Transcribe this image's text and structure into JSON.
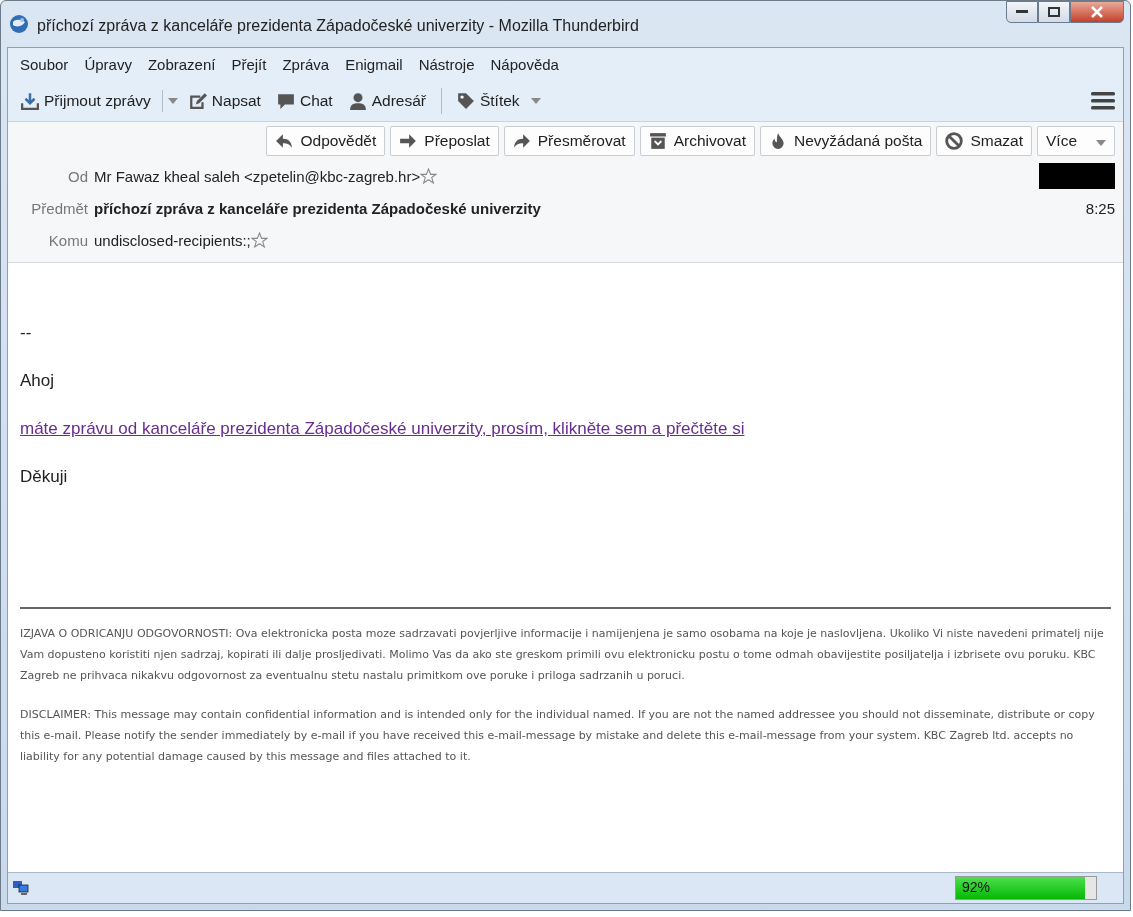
{
  "window": {
    "title": "příchozí zpráva z kanceláře prezidenta Západočeské univerzity - Mozilla Thunderbird"
  },
  "menu": [
    {
      "label": "Soubor"
    },
    {
      "label": "Úpravy"
    },
    {
      "label": "Zobrazení"
    },
    {
      "label": "Přejít"
    },
    {
      "label": "Zpráva"
    },
    {
      "label": "Enigmail"
    },
    {
      "label": "Nástroje"
    },
    {
      "label": "Nápověda"
    }
  ],
  "toolbar": [
    {
      "label": "Přijmout zprávy",
      "kind": "download",
      "dropdown": true
    },
    {
      "label": "Napsat",
      "kind": "compose",
      "dropdown": false
    },
    {
      "label": "Chat",
      "kind": "chat",
      "dropdown": false
    },
    {
      "label": "Adresář",
      "kind": "person",
      "dropdown": false
    },
    {
      "label": "Štítek",
      "kind": "tag",
      "dropdown": true
    }
  ],
  "actions": [
    {
      "label": "Odpovědět",
      "kind": "reply"
    },
    {
      "label": "Přeposlat",
      "kind": "forward"
    },
    {
      "label": "Přesměrovat",
      "kind": "redirect"
    },
    {
      "label": "Archivovat",
      "kind": "archive"
    },
    {
      "label": "Nevyžádaná pošta",
      "kind": "junk"
    },
    {
      "label": "Smazat",
      "kind": "delete"
    },
    {
      "label": "Více",
      "kind": "more"
    }
  ],
  "headers": [
    {
      "label": "Od",
      "value": "Mr Fawaz kheal saleh <zpetelin@kbc-zagreb.hr>",
      "star": true,
      "bold": false,
      "redacted": true
    },
    {
      "label": "Předmět",
      "value": "příchozí zpráva z kanceláře prezidenta Západočeské univerzity",
      "star": false,
      "bold": true,
      "redacted": false,
      "time": "8:25"
    },
    {
      "label": "Komu",
      "value": "undisclosed-recipients:;",
      "star": true,
      "bold": false,
      "redacted": false
    }
  ],
  "body": {
    "signature_dash": "--",
    "greeting": "Ahoj",
    "link": "máte zprávu od kanceláře prezidenta Západočeské univerzity, prosím, klikněte sem a přečtěte si",
    "closing": "Děkuji"
  },
  "disclaimers": [
    "IZJAVA O ODRICANJU ODGOVORNOSTI: Ova elektronicka posta moze sadrzavati povjerljive informacije i namijenjena je samo osobama na koje je naslovljena. Ukoliko Vi niste navedeni primatelj nije Vam dopusteno koristiti njen sadrzaj, kopirati ili dalje prosljedivati. Molimo Vas da ako ste greskom primili ovu elektronicku postu o tome odmah obavijestite posiljatelja i izbrisete ovu poruku. KBC Zagreb ne prihvaca nikakvu odgovornost za eventualnu stetu nastalu primitkom ove poruke i priloga sadrzanih u poruci.",
    "DISCLAIMER: This message may contain confidential information and is intended only for the individual named. If you are not the named addressee you should not disseminate, distribute or copy this e-mail. Please notify the sender immediately by e-mail if you have received this e-mail-message by mistake and delete this e-mail-message from your system. KBC Zagreb ltd. accepts no liability for any potential damage caused by this message and files attached to it."
  ],
  "status_bar": {
    "progress": {
      "level": 0.92,
      "reading": "92%"
    }
  }
}
